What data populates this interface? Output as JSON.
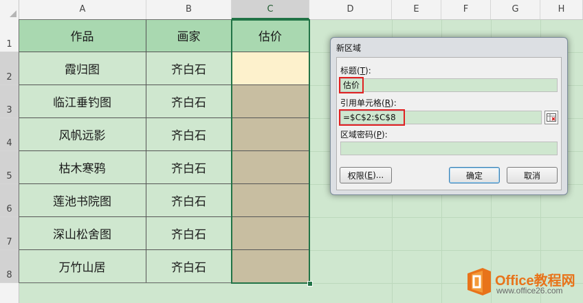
{
  "columns": [
    "A",
    "B",
    "C",
    "D",
    "E",
    "F",
    "G",
    "H"
  ],
  "rows": [
    "1",
    "2",
    "3",
    "4",
    "5",
    "6",
    "7",
    "8"
  ],
  "table": {
    "headers": [
      "作品",
      "画家",
      "估价"
    ],
    "rows": [
      {
        "work": "霞归图",
        "artist": "齐白石"
      },
      {
        "work": "临江垂钓图",
        "artist": "齐白石"
      },
      {
        "work": "风帆远影",
        "artist": "齐白石"
      },
      {
        "work": "枯木寒鸦",
        "artist": "齐白石"
      },
      {
        "work": "莲池书院图",
        "artist": "齐白石"
      },
      {
        "work": "深山松舍图",
        "artist": "齐白石"
      },
      {
        "work": "万竹山居",
        "artist": "齐白石"
      }
    ]
  },
  "dialog": {
    "title": "新区域",
    "title_label": "标题",
    "title_key": "T",
    "title_value": "估价",
    "ref_label": "引用单元格",
    "ref_key": "R",
    "ref_value": "=$C$2:$C$8",
    "password_label": "区域密码",
    "password_key": "P",
    "password_value": "",
    "permissions_label": "权限",
    "permissions_key": "E",
    "ok_label": "确定",
    "cancel_label": "取消"
  },
  "watermark": {
    "brand": "Office教程网",
    "url": "www.office26.com"
  },
  "colors": {
    "header_fill": "#a9d8b0",
    "body_fill": "#cfe7cf",
    "active_cell_fill": "#fdf1cc",
    "selected_fill": "#c8bea1",
    "selection_border": "#217346",
    "highlight_red": "#e02020"
  }
}
